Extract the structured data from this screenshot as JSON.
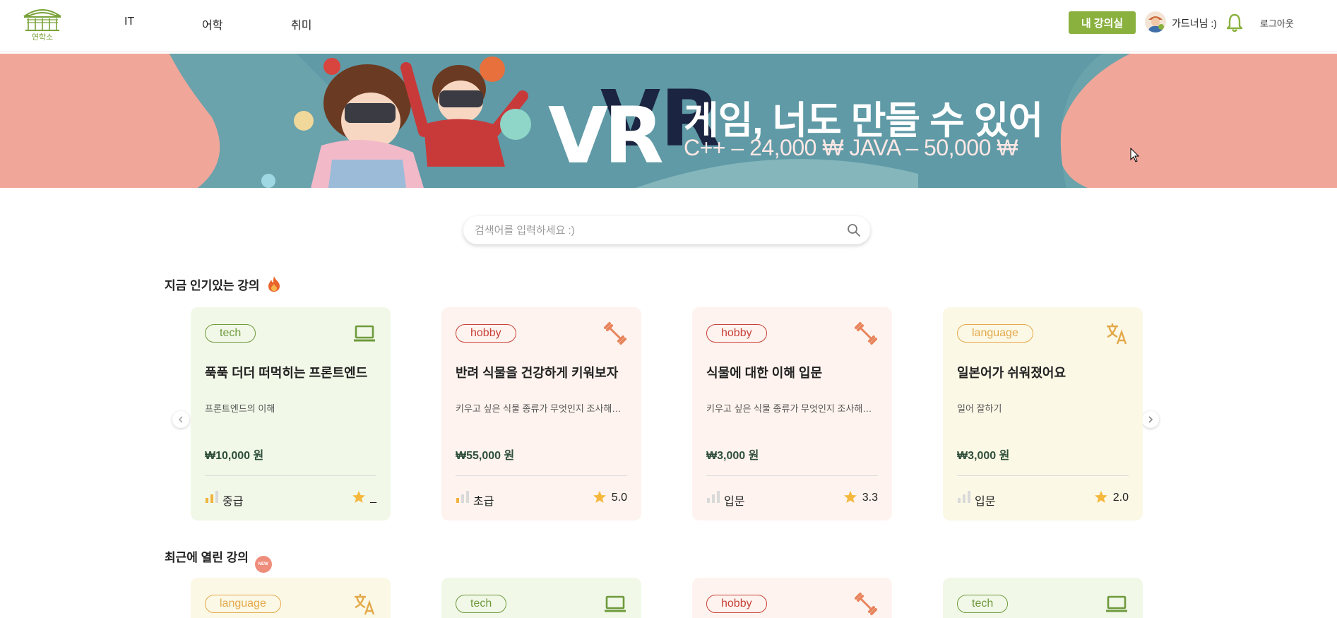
{
  "header": {
    "logo_text": "연학소",
    "nav": [
      "IT",
      "어학",
      "취미"
    ],
    "my_class_label": "내 강의실",
    "username": "가드너님 :)",
    "logout_label": "로그아웃"
  },
  "banner": {
    "vr_text": "VR",
    "title": "게임, 너도 만들 수 있어",
    "price_line": "C++ – 24,000 ₩   JAVA – 50,000 ₩"
  },
  "search": {
    "placeholder": "검색어를 입력하세요 :)",
    "value": ""
  },
  "sections": {
    "popular_title": "지금 인기있는 강의",
    "recent_title": "최근에 열린 강의",
    "new_badge": "NEW"
  },
  "popular_cards": [
    {
      "tag": "tech",
      "title": "푹푹 더더 떠먹히는 프론트엔드",
      "desc": "프론트엔드의 이해",
      "price": "₩10,000 원",
      "level": "중급",
      "rating": "_",
      "icon": "laptop-icon"
    },
    {
      "tag": "hobby",
      "title": "반려 식물을 건강하게 키워보자",
      "desc": "키우고 싶은 식물 종류가 무엇인지 조사해보기",
      "price": "₩55,000 원",
      "level": "초급",
      "rating": "5.0",
      "icon": "dumbbell-icon"
    },
    {
      "tag": "hobby",
      "title": "식물에 대한 이해 입문",
      "desc": "키우고 싶은 식물 종류가 무엇인지 조사해보기",
      "price": "₩3,000 원",
      "level": "입문",
      "rating": "3.3",
      "icon": "dumbbell-icon"
    },
    {
      "tag": "language",
      "title": "일본어가 쉬워졌어요",
      "desc": "일어 잘하기",
      "price": "₩3,000 원",
      "level": "입문",
      "rating": "2.0",
      "icon": "translate-icon"
    }
  ],
  "recent_cards": [
    {
      "tag": "language",
      "icon": "translate-icon"
    },
    {
      "tag": "tech",
      "icon": "laptop-icon"
    },
    {
      "tag": "hobby",
      "icon": "dumbbell-icon"
    },
    {
      "tag": "tech",
      "icon": "laptop-icon"
    }
  ],
  "colors": {
    "accent": "#8ab13e",
    "tech": "#6f9a3c",
    "hobby": "#c8413a",
    "language": "#e3a94a"
  }
}
